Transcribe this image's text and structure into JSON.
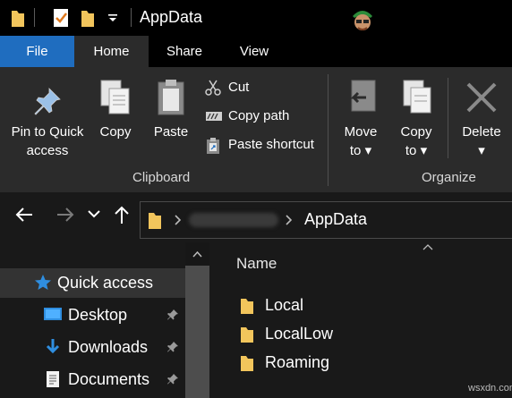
{
  "window": {
    "title": "AppData"
  },
  "ribbon_tabs": {
    "file": "File",
    "home": "Home",
    "share": "Share",
    "view": "View"
  },
  "clipboard": {
    "pin_label_line1": "Pin to Quick",
    "pin_label_line2": "access",
    "copy": "Copy",
    "paste": "Paste",
    "cut": "Cut",
    "copy_path": "Copy path",
    "paste_shortcut": "Paste shortcut",
    "group_label": "Clipboard"
  },
  "organize": {
    "move_line1": "Move",
    "move_line2": "to",
    "copy_line1": "Copy",
    "copy_line2": "to",
    "delete": "Delete",
    "group_label": "Organize"
  },
  "address": {
    "current": "AppData"
  },
  "nav": {
    "quick_access": "Quick access",
    "items": [
      {
        "label": "Desktop",
        "icon": "desktop-icon"
      },
      {
        "label": "Downloads",
        "icon": "download-arrow-icon"
      },
      {
        "label": "Documents",
        "icon": "document-icon"
      }
    ]
  },
  "content": {
    "column_name": "Name",
    "folders": [
      "Local",
      "LocalLow",
      "Roaming"
    ]
  },
  "watermark": "wsxdn.com",
  "colors": {
    "accent": "#1f6dbf",
    "folder": "#f2c55c",
    "quick_access_star": "#2f8ee0"
  }
}
